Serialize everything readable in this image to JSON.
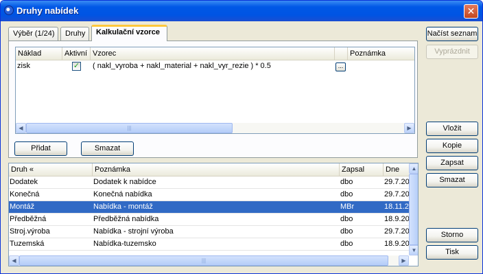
{
  "window": {
    "title": "Druhy nabídek",
    "close_glyph": "✕"
  },
  "tabs": [
    {
      "label": "Výběr (1/24)"
    },
    {
      "label": "Druhy"
    },
    {
      "label": "Kalkulační vzorce"
    }
  ],
  "formula_grid": {
    "columns": [
      "Náklad",
      "Aktivní",
      "Vzorec",
      "",
      "Poznámka"
    ],
    "rows": [
      {
        "naklad": "zisk",
        "aktivni": true,
        "vzorec": "( nakl_vyroba + nakl_material + nakl_vyr_rezie )  * 0.5",
        "button": "...",
        "poznamka": ""
      }
    ]
  },
  "panel_buttons": {
    "pridat": "Přidat",
    "smazat": "Smazat"
  },
  "types_grid": {
    "columns": [
      "Druh «",
      "Poznámka",
      "Zapsal",
      "Dne"
    ],
    "rows": [
      {
        "druh": "Dodatek",
        "poznamka": "Dodatek k nabídce",
        "zapsal": "dbo",
        "dne": "29.7.20",
        "selected": false
      },
      {
        "druh": "Konečná",
        "poznamka": "Konečná nabídka",
        "zapsal": "dbo",
        "dne": "29.7.20",
        "selected": false
      },
      {
        "druh": "Montáž",
        "poznamka": "Nabídka - montáž",
        "zapsal": "MBr",
        "dne": "18.11.2",
        "selected": true
      },
      {
        "druh": "Předběžná",
        "poznamka": "Předběžná nabídka",
        "zapsal": "dbo",
        "dne": "18.9.20",
        "selected": false
      },
      {
        "druh": "Stroj.výroba",
        "poznamka": "Nabídka - strojní výroba",
        "zapsal": "dbo",
        "dne": "29.7.20",
        "selected": false
      },
      {
        "druh": "Tuzemská",
        "poznamka": "Nabídka-tuzemsko",
        "zapsal": "dbo",
        "dne": "18.9.20",
        "selected": false
      }
    ]
  },
  "right_buttons": {
    "nacist_seznam": "Načíst seznam",
    "vyprazdnit": "Vyprázdnit",
    "vlozit": "Vložit",
    "kopie": "Kopie",
    "zapsat": "Zapsat",
    "smazat": "Smazat",
    "storno": "Storno",
    "tisk": "Tisk"
  },
  "scroll_glyphs": {
    "left": "◀",
    "right": "▶",
    "up": "▲",
    "down": "▼",
    "grip": "|||"
  },
  "colors": {
    "selection": "#316ac5",
    "titlebar": "#0054e3",
    "active_tab_accent": "#ffc83c"
  }
}
